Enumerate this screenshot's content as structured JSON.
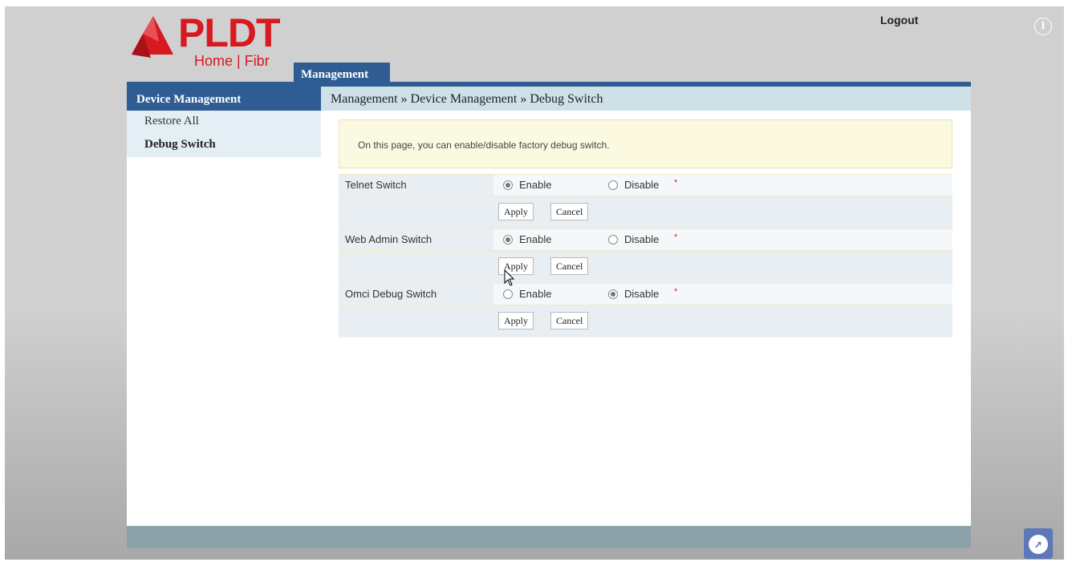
{
  "brand": {
    "name": "PLDT",
    "subtitle": "Home | Fibr",
    "color": "#d71920"
  },
  "header": {
    "logout_label": "Logout",
    "info_icon": "i",
    "tab_label": "Management"
  },
  "sidebar": {
    "title": "Device Management",
    "items": [
      {
        "label": "Restore All",
        "active": false
      },
      {
        "label": "Debug Switch",
        "active": true
      }
    ]
  },
  "breadcrumb": "Management » Device Management » Debug Switch",
  "notice": "On this page, you can enable/disable factory debug switch.",
  "switches": [
    {
      "label": "Telnet Switch",
      "enable_label": "Enable",
      "disable_label": "Disable",
      "selected": "Enable",
      "required_mark": "*",
      "apply_label": "Apply",
      "cancel_label": "Cancel"
    },
    {
      "label": "Web Admin Switch",
      "enable_label": "Enable",
      "disable_label": "Disable",
      "selected": "Enable",
      "required_mark": "*",
      "apply_label": "Apply",
      "cancel_label": "Cancel"
    },
    {
      "label": "Omci Debug Switch",
      "enable_label": "Enable",
      "disable_label": "Disable",
      "selected": "Disable",
      "required_mark": "*",
      "apply_label": "Apply",
      "cancel_label": "Cancel"
    }
  ],
  "colors": {
    "accent": "#2f5d93",
    "required": "#d62b2b"
  }
}
